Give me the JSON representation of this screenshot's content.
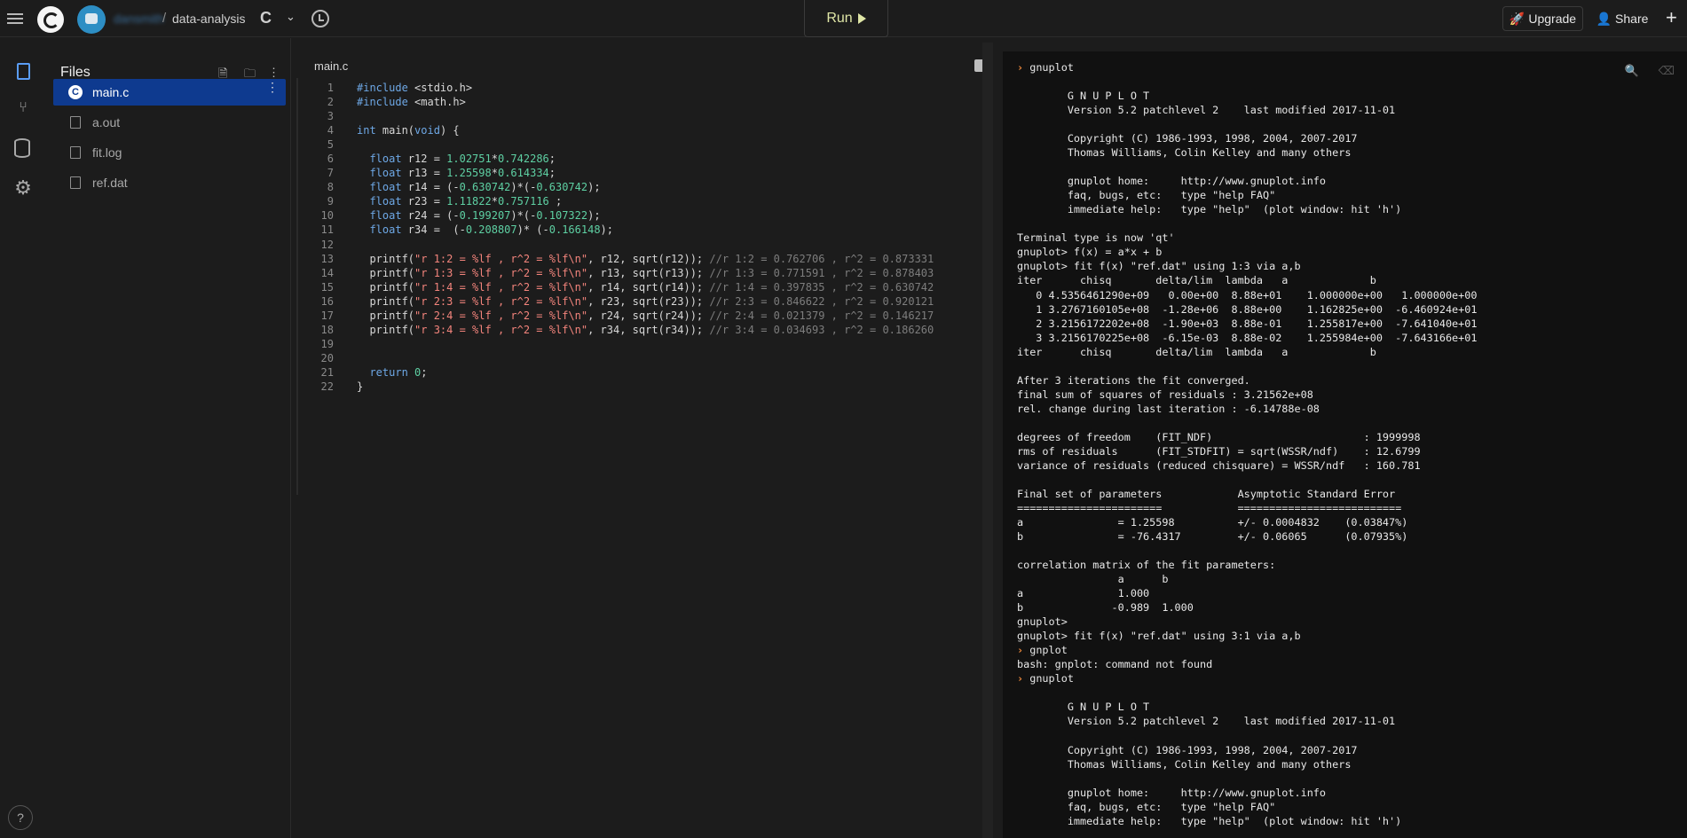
{
  "header": {
    "username": "dansmith",
    "slash": "/",
    "project": "data-analysis",
    "lang_glyph": "C",
    "chevron": "⌄",
    "run_label": "Run",
    "upgrade_label": "Upgrade",
    "share_label": "Share",
    "plus": "+"
  },
  "rail": {
    "help": "?"
  },
  "files": {
    "title": "Files",
    "items": [
      {
        "name": "main.c",
        "active": true
      },
      {
        "name": "a.out"
      },
      {
        "name": "fit.log"
      },
      {
        "name": "ref.dat"
      }
    ]
  },
  "editor": {
    "tab": "main.c",
    "lines": [
      "1",
      "2",
      "3",
      "4",
      "5",
      "6",
      "7",
      "8",
      "9",
      "10",
      "11",
      "12",
      "13",
      "14",
      "15",
      "16",
      "17",
      "18",
      "19",
      "20",
      "21",
      "22"
    ]
  },
  "console": {
    "text": [
      "gnuplot",
      "",
      "        G N U P L O T",
      "        Version 5.2 patchlevel 2    last modified 2017-11-01",
      "",
      "        Copyright (C) 1986-1993, 1998, 2004, 2007-2017",
      "        Thomas Williams, Colin Kelley and many others",
      "",
      "        gnuplot home:     http://www.gnuplot.info",
      "        faq, bugs, etc:   type \"help FAQ\"",
      "        immediate help:   type \"help\"  (plot window: hit 'h')",
      "",
      "Terminal type is now 'qt'",
      "gnuplot> f(x) = a*x + b",
      "gnuplot> fit f(x) \"ref.dat\" using 1:3 via a,b",
      "iter      chisq       delta/lim  lambda   a             b",
      "   0 4.5356461290e+09   0.00e+00  8.88e+01    1.000000e+00   1.000000e+00",
      "   1 3.2767160105e+08  -1.28e+06  8.88e+00    1.162825e+00  -6.460924e+01",
      "   2 3.2156172202e+08  -1.90e+03  8.88e-01    1.255817e+00  -7.641040e+01",
      "   3 3.2156170225e+08  -6.15e-03  8.88e-02    1.255984e+00  -7.643166e+01",
      "iter      chisq       delta/lim  lambda   a             b",
      "",
      "After 3 iterations the fit converged.",
      "final sum of squares of residuals : 3.21562e+08",
      "rel. change during last iteration : -6.14788e-08",
      "",
      "degrees of freedom    (FIT_NDF)                        : 1999998",
      "rms of residuals      (FIT_STDFIT) = sqrt(WSSR/ndf)    : 12.6799",
      "variance of residuals (reduced chisquare) = WSSR/ndf   : 160.781",
      "",
      "Final set of parameters            Asymptotic Standard Error",
      "=======================            ==========================",
      "a               = 1.25598          +/- 0.0004832    (0.03847%)",
      "b               = -76.4317         +/- 0.06065      (0.07935%)",
      "",
      "correlation matrix of the fit parameters:",
      "                a      b",
      "a               1.000",
      "b              -0.989  1.000",
      "gnuplot>",
      "gnuplot> fit f(x) \"ref.dat\" using 3:1 via a,b",
      "gnplot",
      "bash: gnplot: command not found",
      "gnuplot",
      "",
      "        G N U P L O T",
      "        Version 5.2 patchlevel 2    last modified 2017-11-01",
      "",
      "        Copyright (C) 1986-1993, 1998, 2004, 2007-2017",
      "        Thomas Williams, Colin Kelley and many others",
      "",
      "        gnuplot home:     http://www.gnuplot.info",
      "        faq, bugs, etc:   type \"help FAQ\"",
      "        immediate help:   type \"help\"  (plot window: hit 'h')"
    ],
    "prompt_lines": [
      0,
      41,
      43
    ],
    "prompt_glyph": "›"
  },
  "colors": {
    "accent": "#0e3a8f",
    "run": "#dfe6a6",
    "prompt": "#f08a3c",
    "keyword": "#6ea8e6",
    "number": "#5ed0a3",
    "string": "#f3847c"
  }
}
